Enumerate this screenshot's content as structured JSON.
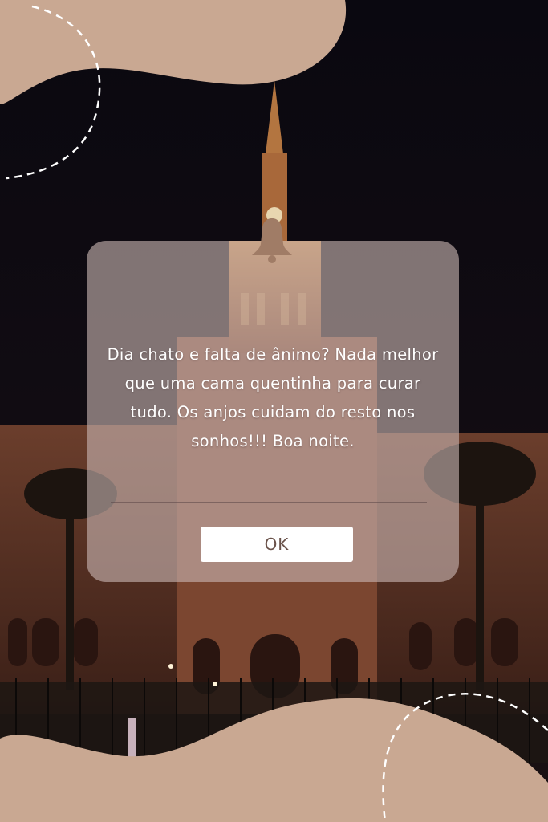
{
  "dialog": {
    "message": "Dia chato e falta de ânimo? Nada melhor que uma cama quentinha para curar tudo. Os anjos cuidam do resto nos sonhos!!! Boa noite.",
    "ok_label": "OK"
  },
  "icons": {
    "bell": "bell-icon"
  },
  "colors": {
    "blob": "#c9a892",
    "night_sky": "#0d0b10",
    "bell": "#a07c66",
    "dialog_overlay": "#c8b4b2",
    "button_text": "#6a524a"
  }
}
